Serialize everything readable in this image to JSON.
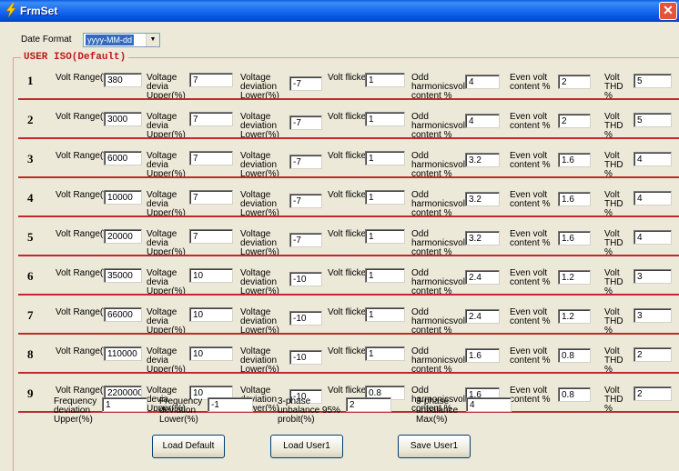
{
  "window": {
    "title": "FrmSet",
    "close_glyph": "✕"
  },
  "date_format": {
    "label": "Date Format",
    "value": "yyyy-MM-dd"
  },
  "group": {
    "title": "USER ISO(Default)"
  },
  "labels": {
    "volt_range": "Volt Range(V",
    "voltage_dev_upper": [
      "Voltage devia",
      "Upper(%)"
    ],
    "voltage_dev_lower": [
      "Voltage",
      "deviation",
      "Lower(%)"
    ],
    "volt_flicker": "Volt flicker",
    "odd_harmonics": [
      "Odd",
      "harmonicsvolt",
      "content %"
    ],
    "even_volt": [
      "Even volt",
      "content %"
    ],
    "volt_thd": [
      "Volt",
      "THD %"
    ]
  },
  "rows": [
    {
      "num": "1",
      "volt_range": "380",
      "dev_upper": "7",
      "dev_lower": "-7",
      "flicker": "1",
      "odd": "4",
      "even": "2",
      "thd": "5"
    },
    {
      "num": "2",
      "volt_range": "3000",
      "dev_upper": "7",
      "dev_lower": "-7",
      "flicker": "1",
      "odd": "4",
      "even": "2",
      "thd": "5"
    },
    {
      "num": "3",
      "volt_range": "6000",
      "dev_upper": "7",
      "dev_lower": "-7",
      "flicker": "1",
      "odd": "3.2",
      "even": "1.6",
      "thd": "4"
    },
    {
      "num": "4",
      "volt_range": "10000",
      "dev_upper": "7",
      "dev_lower": "-7",
      "flicker": "1",
      "odd": "3.2",
      "even": "1.6",
      "thd": "4"
    },
    {
      "num": "5",
      "volt_range": "20000",
      "dev_upper": "7",
      "dev_lower": "-7",
      "flicker": "1",
      "odd": "3.2",
      "even": "1.6",
      "thd": "4"
    },
    {
      "num": "6",
      "volt_range": "35000",
      "dev_upper": "10",
      "dev_lower": "-10",
      "flicker": "1",
      "odd": "2.4",
      "even": "1.2",
      "thd": "3"
    },
    {
      "num": "7",
      "volt_range": "66000",
      "dev_upper": "10",
      "dev_lower": "-10",
      "flicker": "1",
      "odd": "2.4",
      "even": "1.2",
      "thd": "3"
    },
    {
      "num": "8",
      "volt_range": "110000",
      "dev_upper": "10",
      "dev_lower": "-10",
      "flicker": "1",
      "odd": "1.6",
      "even": "0.8",
      "thd": "2"
    },
    {
      "num": "9",
      "volt_range": "2200000",
      "dev_upper": "10",
      "dev_lower": "-10",
      "flicker": "0.8",
      "odd": "1.6",
      "even": "0.8",
      "thd": "2"
    }
  ],
  "bottom": {
    "freq_upper": {
      "label": [
        "Frequency",
        "deviation",
        "Upper(%)"
      ],
      "value": "1"
    },
    "freq_lower": {
      "label": [
        "Frequency",
        "deviation",
        "Lower(%)"
      ],
      "value": "-1"
    },
    "unbalance_95": {
      "label": [
        "3-phase",
        "unbalance 95%",
        "probit(%)"
      ],
      "value": "2"
    },
    "unbalance_max": {
      "label": [
        "3-phase",
        "unbalance",
        "Max(%)"
      ],
      "value": "4"
    }
  },
  "buttons": {
    "load_default": "Load Default",
    "load_user1": "Load User1",
    "save_user1": "Save User1"
  }
}
